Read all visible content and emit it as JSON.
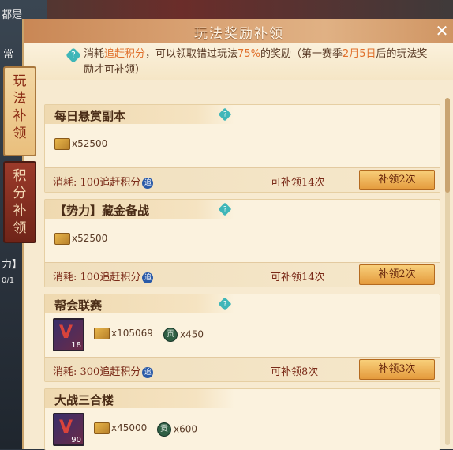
{
  "background": {
    "left_texts": [
      "都是",
      "常",
      "力】",
      "0/1"
    ]
  },
  "panel": {
    "title": "玩法奖励补领",
    "close_glyph": "✕",
    "notice": {
      "help_glyph": "?",
      "part1": "消耗",
      "highlight1": "追赶积分",
      "part2": "，可以领取错过玩法",
      "highlight2": "75%",
      "part3": "的奖励（第一赛季",
      "highlight3": "2月5日",
      "part4": "后的玩法奖励才可补领）"
    }
  },
  "tabs": [
    {
      "label": "玩法补领",
      "active": true
    },
    {
      "label": "积分补领",
      "active": false
    }
  ],
  "cards": [
    {
      "title": "每日悬赏副本",
      "rewards": [
        {
          "icon": "scroll-icon",
          "text": "x52500"
        }
      ],
      "cost": "消耗: 100追赶积分",
      "chase_glyph": "追",
      "remaining": "可补领14次",
      "button": "补领2次"
    },
    {
      "title": "【势力】藏金备战",
      "rewards": [
        {
          "icon": "scroll-icon",
          "text": "x52500"
        }
      ],
      "cost": "消耗: 100追赶积分",
      "chase_glyph": "追",
      "remaining": "可补领14次",
      "button": "补领2次"
    },
    {
      "title": "帮会联赛",
      "badge_level": "18",
      "rewards": [
        {
          "icon": "scroll-icon",
          "text": "x105069"
        },
        {
          "icon": "tribute-icon",
          "glyph": "贡",
          "text": "x450"
        }
      ],
      "cost": "消耗: 300追赶积分",
      "chase_glyph": "追",
      "remaining": "可补领8次",
      "button": "补领3次"
    },
    {
      "title": "大战三合楼",
      "badge_level": "90",
      "rewards": [
        {
          "icon": "scroll-icon",
          "text": "x45000"
        },
        {
          "icon": "tribute-icon",
          "glyph": "贡",
          "text": "x600"
        }
      ]
    }
  ],
  "colors": {
    "accent_orange": "#e0702c",
    "panel_bg": "#f7ead0",
    "button": "#e49a3c"
  }
}
